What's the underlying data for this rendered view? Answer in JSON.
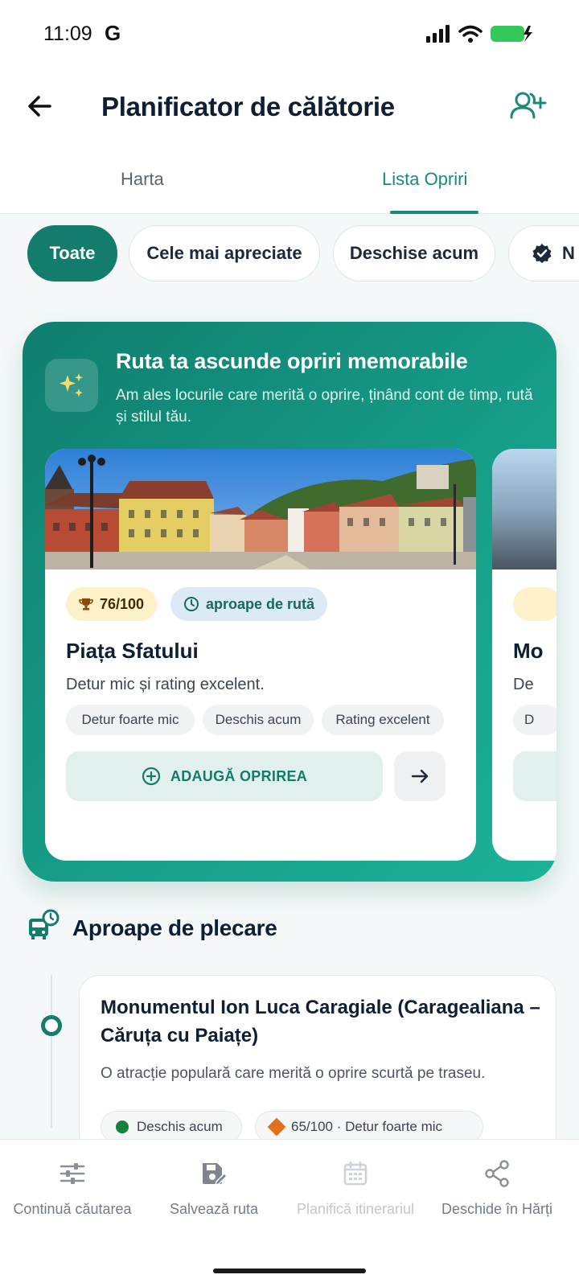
{
  "status": {
    "time": "11:09",
    "g_label": "G"
  },
  "header": {
    "title": "Planificator de călătorie",
    "back_icon": "arrow-left-icon",
    "action_icon": "add-person-icon"
  },
  "tabs": [
    {
      "label": "Harta",
      "active": false
    },
    {
      "label": "Lista Opriri",
      "active": true
    }
  ],
  "filters": [
    {
      "label": "Toate",
      "active": true
    },
    {
      "label": "Cele mai apreciate",
      "active": false
    },
    {
      "label": "Deschise acum",
      "active": false
    },
    {
      "label": "N",
      "active": false,
      "icon": "verified-badge-icon"
    }
  ],
  "promo": {
    "title": "Ruta ta ascunde opriri memorabile",
    "subtitle": "Am ales locurile care merită o oprire, ținând cont de timp, rută și stilul tău.",
    "cards": [
      {
        "score": "76/100",
        "route_badge": "aproape de rută",
        "name": "Piața Sfatului",
        "description": "Detur mic și rating excelent.",
        "tags": [
          "Detur foarte mic",
          "Deschis acum",
          "Rating excelent"
        ],
        "add_label": "ADAUGĂ OPRIREA"
      },
      {
        "name": "Mo",
        "description": "De",
        "tag": "D"
      }
    ]
  },
  "nearby": {
    "title": "Aproape de plecare",
    "stops": [
      {
        "name": "Monumentul Ion Luca Caragiale (Caragealiana – Căruța cu Paiațe)",
        "description": "O atracție populară care merită o oprire scurtă pe traseu.",
        "chips": [
          "Deschis acum",
          "65/100 · Detur foarte mic"
        ]
      }
    ]
  },
  "bottom_nav": [
    {
      "label": "Continuă căutarea",
      "icon": "sliders-icon",
      "disabled": false
    },
    {
      "label": "Salvează ruta",
      "icon": "save-edit-icon",
      "disabled": false
    },
    {
      "label": "Planifică itinerariul",
      "icon": "calendar-icon",
      "disabled": true
    },
    {
      "label": "Deschide în Hărți",
      "icon": "share-icon",
      "disabled": false
    }
  ],
  "colors": {
    "primary": "#147c6c",
    "accent": "#1b8a78",
    "promo_from": "#0f7e6e",
    "promo_to": "#1bb299"
  }
}
